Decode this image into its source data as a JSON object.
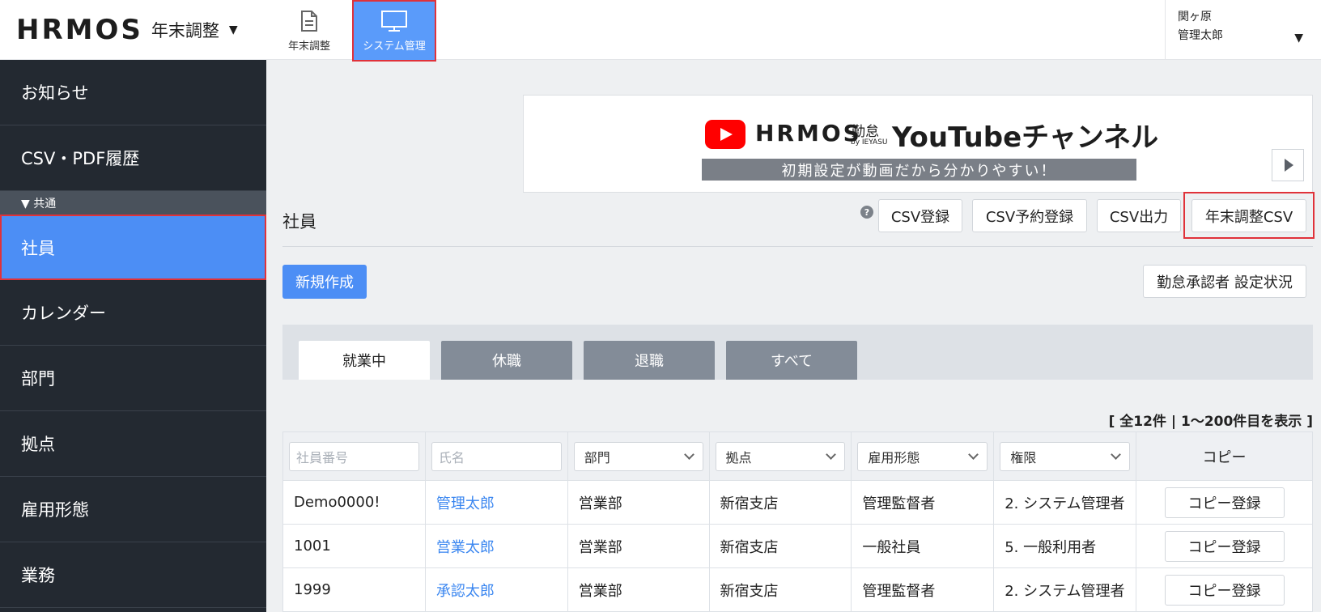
{
  "header": {
    "logo": "HRMOS",
    "product": "年末調整",
    "nav": [
      {
        "label": "年末調整",
        "icon": "document-icon"
      },
      {
        "label": "システム管理",
        "icon": "monitor-icon"
      }
    ],
    "user": {
      "org": "関ヶ原",
      "name": "管理太郎"
    }
  },
  "sidebar": {
    "items_top": [
      "お知らせ",
      "CSV・PDF履歴"
    ],
    "section": "▼ 共通",
    "items": [
      "社員",
      "カレンダー",
      "部門",
      "拠点",
      "雇用形態",
      "業務"
    ]
  },
  "banner": {
    "logo": "HRMOS",
    "kintai": "勤怠",
    "by": "by IEYASU",
    "youtube": "YouTubeチャンネル",
    "subtitle": "初期設定が動画だから分かりやすい！"
  },
  "page": {
    "title": "社員",
    "help": "?",
    "csv_buttons": [
      "CSV登録",
      "CSV予約登録",
      "CSV出力",
      "年末調整CSV"
    ],
    "new_button": "新規作成",
    "approver_button": "勤怠承認者 設定状況",
    "tabs": [
      "就業中",
      "休職",
      "退職",
      "すべて"
    ],
    "count": "[ 全12件 | 1〜200件目を表示 ]"
  },
  "table": {
    "filters": {
      "employee_no_placeholder": "社員番号",
      "name_placeholder": "氏名",
      "dept": "部門",
      "base": "拠点",
      "employment": "雇用形態",
      "role": "権限",
      "copy": "コピー"
    },
    "rows": [
      {
        "no": "Demo0000!",
        "name": "管理太郎",
        "dept": "営業部",
        "base": "新宿支店",
        "employment": "管理監督者",
        "role": "2. システム管理者",
        "copy": "コピー登録"
      },
      {
        "no": "1001",
        "name": "営業太郎",
        "dept": "営業部",
        "base": "新宿支店",
        "employment": "一般社員",
        "role": "5. 一般利用者",
        "copy": "コピー登録"
      },
      {
        "no": "1999",
        "name": "承認太郎",
        "dept": "営業部",
        "base": "新宿支店",
        "employment": "管理監督者",
        "role": "2. システム管理者",
        "copy": "コピー登録"
      }
    ]
  },
  "colors": {
    "accent": "#4c8ef5",
    "sidebar": "#232931",
    "highlight": "#e0323a",
    "link": "#3a86f0"
  }
}
